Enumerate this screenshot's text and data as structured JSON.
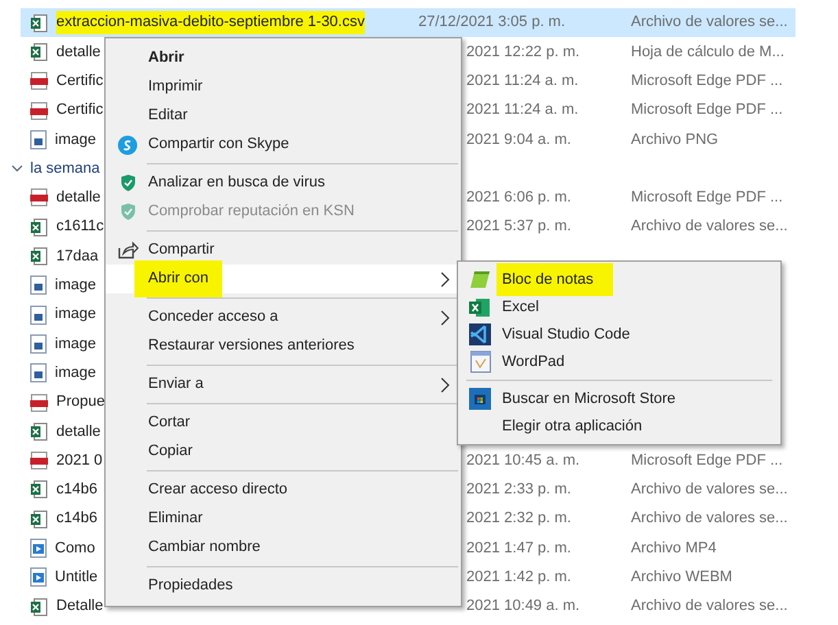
{
  "files": [
    {
      "kind": "csv",
      "name": "extraccion-masiva-debito-septiembre 1-30.csv",
      "date": "27/12/2021 3:05 p. m.",
      "type": "Archivo de valores se...",
      "selected": true,
      "highlighted": true
    },
    {
      "kind": "csv",
      "name": "detalle",
      "date": "2021 12:22 p. m.",
      "type": "Hoja de cálculo de M...",
      "selected": false,
      "highlighted": false
    },
    {
      "kind": "pdf",
      "name": "Certific",
      "date": "2021 11:24 a. m.",
      "type": "Microsoft Edge PDF ...",
      "selected": false,
      "highlighted": false
    },
    {
      "kind": "pdf",
      "name": "Certific",
      "date": "2021 11:24 a. m.",
      "type": "Microsoft Edge PDF ...",
      "selected": false,
      "highlighted": false
    },
    {
      "kind": "png",
      "name": "image",
      "date": "2021 9:04 a. m.",
      "type": "Archivo PNG",
      "selected": false,
      "highlighted": false
    },
    {
      "kind": "group",
      "name": "la semana"
    },
    {
      "kind": "pdf",
      "name": "detalle",
      "date": "2021 6:06 p. m.",
      "type": "Microsoft Edge PDF ...",
      "selected": false,
      "highlighted": false
    },
    {
      "kind": "csv",
      "name": "c1611c",
      "date": "2021 5:37 p. m.",
      "type": "Archivo de valores se...",
      "selected": false,
      "highlighted": false
    },
    {
      "kind": "csv",
      "name": "17daa",
      "selected": false,
      "highlighted": false
    },
    {
      "kind": "png",
      "name": "image",
      "selected": false,
      "highlighted": false
    },
    {
      "kind": "png",
      "name": "image",
      "selected": false,
      "highlighted": false
    },
    {
      "kind": "png",
      "name": "image",
      "selected": false,
      "highlighted": false
    },
    {
      "kind": "png",
      "name": "image",
      "selected": false,
      "highlighted": false
    },
    {
      "kind": "pdf",
      "name": "Propue",
      "selected": false,
      "highlighted": false
    },
    {
      "kind": "csv",
      "name": "detalle",
      "selected": false,
      "highlighted": false
    },
    {
      "kind": "pdf",
      "name": "2021 0",
      "date": "2021 10:45 a. m.",
      "type": "Microsoft Edge PDF ...",
      "selected": false,
      "highlighted": false
    },
    {
      "kind": "csv",
      "name": "c14b6",
      "date": "2021 2:33 p. m.",
      "type": "Archivo de valores se...",
      "selected": false,
      "highlighted": false
    },
    {
      "kind": "csv",
      "name": "c14b6",
      "date": "2021 2:32 p. m.",
      "type": "Archivo de valores se...",
      "selected": false,
      "highlighted": false
    },
    {
      "kind": "video",
      "name": "Como",
      "date": "2021 1:47 p. m.",
      "type": "Archivo MP4",
      "selected": false,
      "highlighted": false
    },
    {
      "kind": "video",
      "name": "Untitle",
      "date": "2021 1:42 p. m.",
      "type": "Archivo WEBM",
      "selected": false,
      "highlighted": false
    },
    {
      "kind": "csv",
      "name": "Detalle",
      "date": "2021 10:49 a. m.",
      "type": "Archivo de valores se...",
      "selected": false,
      "highlighted": false
    }
  ],
  "context_menu": [
    {
      "kind": "plain",
      "label": "Abrir",
      "default": true
    },
    {
      "kind": "plain",
      "label": "Imprimir"
    },
    {
      "kind": "plain",
      "label": "Editar"
    },
    {
      "kind": "skype",
      "label": "Compartir con Skype"
    },
    {
      "kind": "separator"
    },
    {
      "kind": "shield",
      "label": "Analizar en busca de virus",
      "disabled": false
    },
    {
      "kind": "shield",
      "label": "Comprobar reputación en KSN",
      "disabled": true
    },
    {
      "kind": "separator"
    },
    {
      "kind": "share",
      "label": "Compartir"
    },
    {
      "kind": "plain",
      "label": "Abrir con",
      "submenu": true,
      "selected": true,
      "highlighted": true
    },
    {
      "kind": "separator"
    },
    {
      "kind": "plain",
      "label": "Conceder acceso a",
      "submenu": true
    },
    {
      "kind": "plain",
      "label": "Restaurar versiones anteriores"
    },
    {
      "kind": "separator"
    },
    {
      "kind": "plain",
      "label": "Enviar a",
      "submenu": true
    },
    {
      "kind": "separator"
    },
    {
      "kind": "plain",
      "label": "Cortar"
    },
    {
      "kind": "plain",
      "label": "Copiar"
    },
    {
      "kind": "separator"
    },
    {
      "kind": "plain",
      "label": "Crear acceso directo"
    },
    {
      "kind": "plain",
      "label": "Eliminar"
    },
    {
      "kind": "plain",
      "label": "Cambiar nombre"
    },
    {
      "kind": "separator"
    },
    {
      "kind": "plain",
      "label": "Propiedades"
    }
  ],
  "open_with_menu": [
    {
      "kind": "notepad",
      "label": "Bloc de notas",
      "highlighted": true
    },
    {
      "kind": "excel",
      "label": "Excel",
      "highlighted": false
    },
    {
      "kind": "vscode",
      "label": "Visual Studio Code",
      "highlighted": false
    },
    {
      "kind": "wordpad",
      "label": "WordPad",
      "highlighted": false
    },
    {
      "kind": "separator"
    },
    {
      "kind": "store",
      "label": "Buscar en Microsoft Store",
      "highlighted": false
    },
    {
      "kind": "plain",
      "label": "Elegir otra aplicación",
      "highlighted": false
    }
  ]
}
